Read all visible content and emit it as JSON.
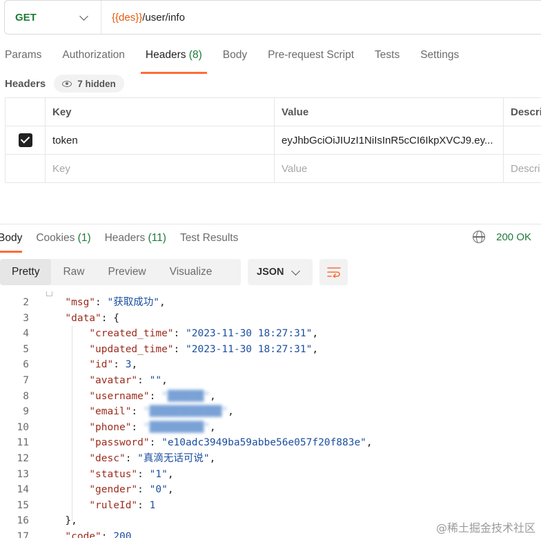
{
  "request": {
    "method": "GET",
    "url_var": "{{des}}",
    "url_path": "/user/info"
  },
  "request_tabs": {
    "params": "Params",
    "authorization": "Authorization",
    "headers": "Headers",
    "headers_count": "(8)",
    "body": "Body",
    "prerequest": "Pre-request Script",
    "tests": "Tests",
    "settings": "Settings"
  },
  "headers_section": {
    "title": "Headers",
    "hidden": "7 hidden",
    "columns": {
      "key": "Key",
      "value": "Value",
      "description": "Descri"
    },
    "rows": [
      {
        "key": "token",
        "value": "eyJhbGciOiJIUzI1NiIsInR5cCI6IkpXVCJ9.ey..."
      }
    ],
    "placeholder": {
      "key": "Key",
      "value": "Value",
      "description": "Descri"
    }
  },
  "response_tabs": {
    "body": "Body",
    "cookies": "Cookies",
    "cookies_count": "(1)",
    "headers": "Headers",
    "headers_count": "(11)",
    "test_results": "Test Results",
    "status": "200 OK"
  },
  "view": {
    "pretty": "Pretty",
    "raw": "Raw",
    "preview": "Preview",
    "visualize": "Visualize",
    "format": "JSON"
  },
  "code": {
    "l2": {
      "n": "2",
      "k": "\"msg\"",
      "v": "\"获取成功\""
    },
    "l3": {
      "n": "3",
      "k": "\"data\""
    },
    "l4": {
      "n": "4",
      "k": "\"created_time\"",
      "v": "\"2023-11-30 18:27:31\""
    },
    "l5": {
      "n": "5",
      "k": "\"updated_time\"",
      "v": "\"2023-11-30 18:27:31\""
    },
    "l6": {
      "n": "6",
      "k": "\"id\"",
      "v": "3"
    },
    "l7": {
      "n": "7",
      "k": "\"avatar\"",
      "v": "\"\""
    },
    "l8": {
      "n": "8",
      "k": "\"username\"",
      "v": "\"██████\""
    },
    "l9": {
      "n": "9",
      "k": "\"email\"",
      "v": "\"████████████\""
    },
    "l10": {
      "n": "10",
      "k": "\"phone\"",
      "v": "\"█████████\""
    },
    "l11": {
      "n": "11",
      "k": "\"password\"",
      "v": "\"e10adc3949ba59abbe56e057f20f883e\""
    },
    "l12": {
      "n": "12",
      "k": "\"desc\"",
      "v": "\"真滴无话可说\""
    },
    "l13": {
      "n": "13",
      "k": "\"status\"",
      "v": "\"1\""
    },
    "l14": {
      "n": "14",
      "k": "\"gender\"",
      "v": "\"0\""
    },
    "l15": {
      "n": "15",
      "k": "\"ruleId\"",
      "v": "1"
    },
    "l16": {
      "n": "16"
    },
    "l17": {
      "n": "17",
      "k": "\"code\"",
      "v": "200"
    }
  },
  "watermark": "@稀土掘金技术社区",
  "colors": {
    "accent": "#ff6c37",
    "success": "#1f7a3a",
    "json_key": "#9b2d1e",
    "json_string": "#1c4fa0"
  }
}
